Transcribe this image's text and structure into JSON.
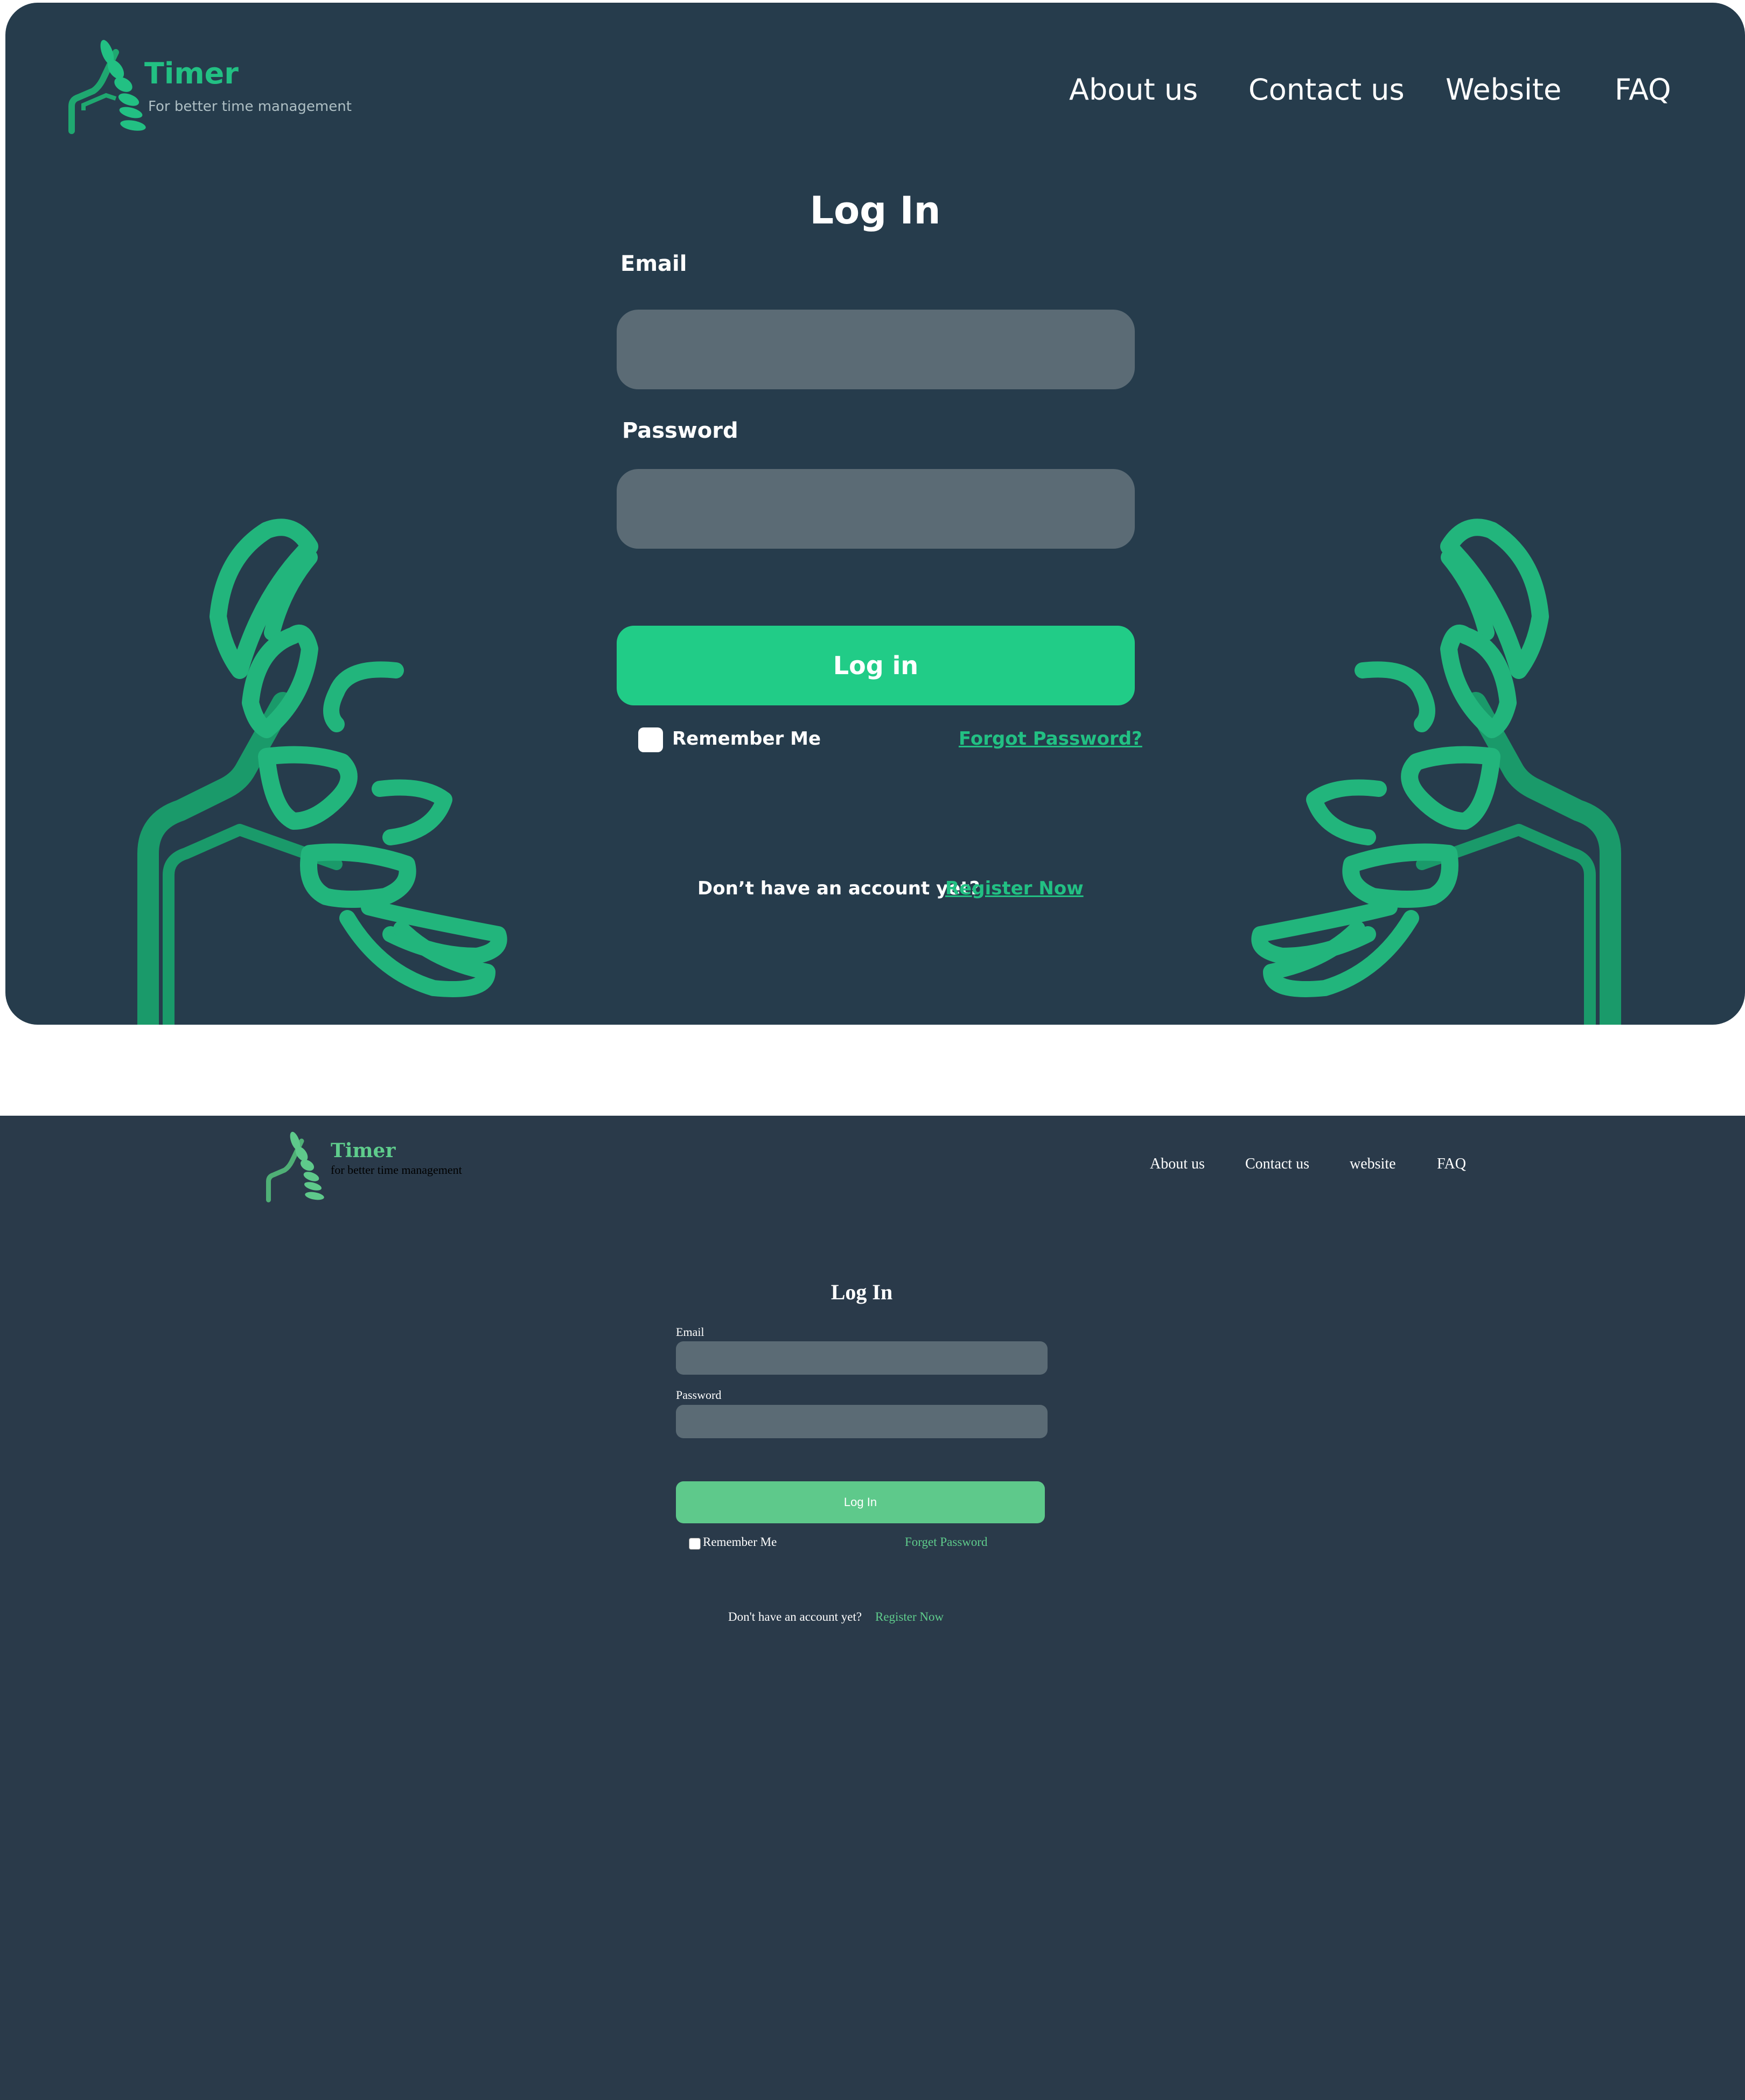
{
  "mockup": {
    "brand": {
      "name": "Timer",
      "tagline": "For better time management"
    },
    "nav": [
      "About us",
      "Contact us",
      "Website",
      "FAQ"
    ],
    "form": {
      "title": "Log In",
      "email_label": "Email",
      "email_value": "",
      "password_label": "Password",
      "password_value": "",
      "submit_label": "Log in",
      "remember_label": "Remember Me",
      "forgot_label": "Forgot Password?",
      "no_account_text": "Don’t have an account yet?",
      "register_label": "Register Now"
    },
    "colors": {
      "background": "#263c4c",
      "accent": "#21cc87",
      "input": "#5b6b75"
    }
  },
  "rendered": {
    "brand": {
      "name": "Timer",
      "tagline": "for better time management"
    },
    "nav": [
      "About us",
      "Contact us",
      "website",
      "FAQ"
    ],
    "form": {
      "title": "Log In",
      "email_label": "Email",
      "email_value": "",
      "password_label": "Password",
      "password_value": "",
      "submit_label": "Log In",
      "remember_label": "Remember Me",
      "forgot_label": "Forget Password",
      "no_account_text": "Don't have an account yet?",
      "register_label": "Register Now"
    },
    "colors": {
      "background": "#2a3a4a",
      "accent": "#5ec98b",
      "input": "#5b6b75"
    }
  },
  "icons": [
    "leaf-logo-icon",
    "leaf-branch-decoration-icon",
    "checkbox-icon"
  ]
}
